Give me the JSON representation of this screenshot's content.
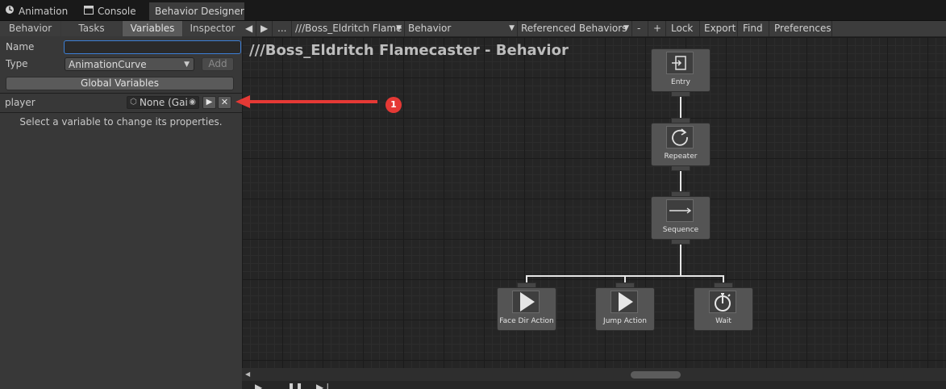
{
  "window_tabs": [
    {
      "label": "Animation",
      "icon": "animation-icon"
    },
    {
      "label": "Console",
      "icon": "console-icon"
    },
    {
      "label": "Behavior Designer",
      "active": true
    }
  ],
  "panel_tabs": [
    "Behavior",
    "Tasks",
    "Variables",
    "Inspector"
  ],
  "active_panel_tab": "Variables",
  "variables_panel": {
    "name_label": "Name",
    "name_value": "",
    "type_label": "Type",
    "type_value": "AnimationCurve",
    "add_label": "Add",
    "global_variables_label": "Global Variables",
    "variable": {
      "name": "player",
      "value": "None (Gai",
      "icon": "cube-icon"
    },
    "hint": "Select a variable to change its properties."
  },
  "toolbar": {
    "ellipsis": "...",
    "object_path": "///Boss_Eldritch Flame",
    "behavior": "Behavior",
    "referenced_behaviors": "Referenced Behaviors",
    "minus": "-",
    "plus": "+",
    "lock": "Lock",
    "export": "Export",
    "find": "Find",
    "preferences": "Preferences"
  },
  "graph": {
    "title": "///Boss_Eldritch Flamecaster - Behavior",
    "nodes": [
      {
        "id": "entry",
        "label": "Entry",
        "icon": "entry-icon"
      },
      {
        "id": "repeater",
        "label": "Repeater",
        "icon": "repeat-icon"
      },
      {
        "id": "sequence",
        "label": "Sequence",
        "icon": "arrow-right-icon"
      },
      {
        "id": "face-dir-action",
        "label": "Face Dir Action",
        "icon": "play-icon"
      },
      {
        "id": "jump-action",
        "label": "Jump Action",
        "icon": "play-icon"
      },
      {
        "id": "wait",
        "label": "Wait",
        "icon": "stopwatch-icon"
      }
    ]
  },
  "annotation": {
    "badge": "1",
    "color": "#e53935"
  },
  "colors": {
    "canvas": "#252525",
    "node": "#545454",
    "wire": "#e6e6e6",
    "focus": "#3d7fd6"
  }
}
